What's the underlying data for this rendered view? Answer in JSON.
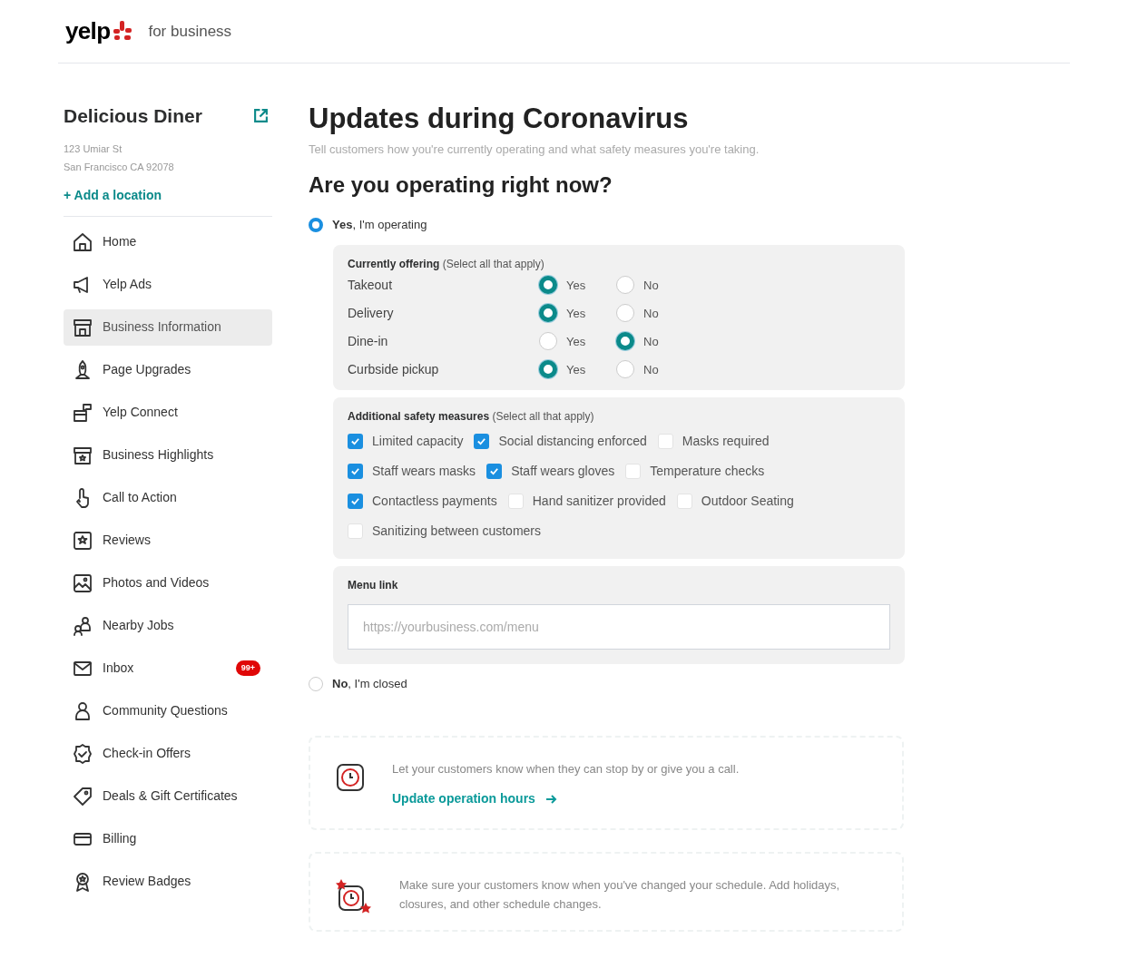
{
  "header": {
    "logo": "yelp",
    "tagline": "for business"
  },
  "business": {
    "name": "Delicious Diner",
    "address_line_1": "123 Umiar St",
    "address_line_2": "San Francisco CA 92078",
    "add_location": "+ Add a location"
  },
  "sidebar": {
    "items": [
      {
        "label": "Home",
        "selected": false
      },
      {
        "label": "Yelp Ads",
        "selected": false
      },
      {
        "label": "Business Information",
        "selected": true
      },
      {
        "label": "Page Upgrades",
        "selected": false
      },
      {
        "label": "Yelp Connect",
        "selected": false
      },
      {
        "label": "Business Highlights",
        "selected": false
      },
      {
        "label": "Call to Action",
        "selected": false
      },
      {
        "label": "Reviews",
        "selected": false
      },
      {
        "label": "Photos and Videos",
        "selected": false
      },
      {
        "label": "Nearby Jobs",
        "selected": false
      },
      {
        "label": "Inbox",
        "selected": false,
        "badge": "99+"
      },
      {
        "label": "Community Questions",
        "selected": false
      },
      {
        "label": "Check-in Offers",
        "selected": false
      },
      {
        "label": "Deals & Gift Certificates",
        "selected": false
      },
      {
        "label": "Billing",
        "selected": false
      },
      {
        "label": "Review Badges",
        "selected": false
      }
    ]
  },
  "main": {
    "title": "Updates during Coronavirus",
    "subtitle": "Tell customers how you're currently operating and what safety measures you're taking.",
    "question": "Are you operating right now?",
    "status_options": [
      {
        "label": "**Yes**, I'm operating",
        "selected": true
      },
      {
        "label": "**No**, I'm closed",
        "selected": false
      }
    ],
    "offering": {
      "heading": "Currently offering",
      "hint": "(Select all that apply)",
      "rows": [
        {
          "label": "Takeout",
          "options": [
            {
              "label": "Yes",
              "selected": true
            },
            {
              "label": "No",
              "selected": false
            }
          ]
        },
        {
          "label": "Delivery",
          "options": [
            {
              "label": "Yes",
              "selected": true
            },
            {
              "label": "No",
              "selected": false
            }
          ]
        },
        {
          "label": "Dine-in",
          "options": [
            {
              "label": "Yes",
              "selected": false
            },
            {
              "label": "No",
              "selected": true
            }
          ]
        },
        {
          "label": "Curbside pickup",
          "options": [
            {
              "label": "Yes",
              "selected": true
            },
            {
              "label": "No",
              "selected": false
            }
          ]
        }
      ]
    },
    "safety": {
      "heading": "Additional safety measures",
      "hint": "(Select all that apply)",
      "items": [
        {
          "label": "Limited capacity",
          "checked": true
        },
        {
          "label": "Social distancing enforced",
          "checked": true
        },
        {
          "label": "Masks required",
          "checked": false
        },
        {
          "label": "Staff wears masks",
          "checked": true
        },
        {
          "label": "Staff wears gloves",
          "checked": true
        },
        {
          "label": "Temperature checks",
          "checked": false
        },
        {
          "label": "Contactless payments",
          "checked": true
        },
        {
          "label": "Hand sanitizer provided",
          "checked": false
        },
        {
          "label": "Outdoor Seating",
          "checked": false
        },
        {
          "label": "Sanitizing between customers",
          "checked": false
        }
      ]
    },
    "menu_link": {
      "label": "Menu link",
      "placeholder": "https://yourbusiness.com/menu"
    },
    "cards": [
      {
        "text": "Let your customers know when they can stop by or give you a call.",
        "link": "Update operation hours"
      },
      {
        "text": "Make sure your customers know when you've changed your schedule. Add holidays, closures, and other schedule changes."
      }
    ]
  }
}
